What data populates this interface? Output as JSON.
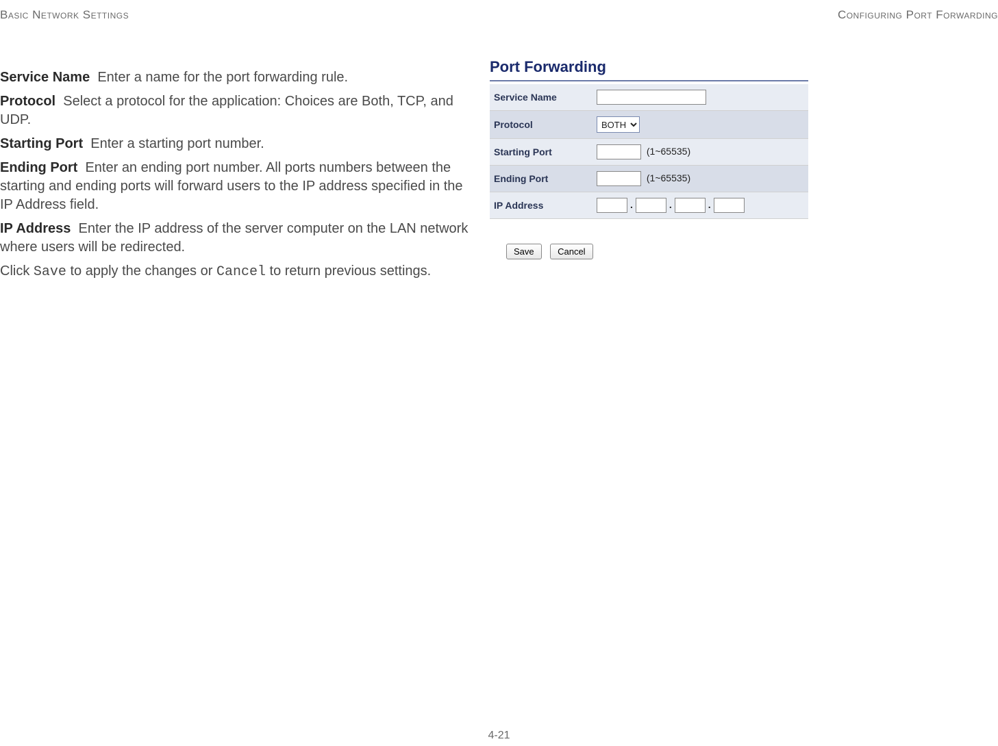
{
  "header": {
    "left": "Basic Network Settings",
    "right": "Configuring Port Forwarding"
  },
  "definitions": {
    "service_name": {
      "term": "Service Name",
      "desc": "Enter a name for the port forwarding rule."
    },
    "protocol": {
      "term": "Protocol",
      "desc": "Select a protocol for the application: Choices are Both, TCP, and UDP."
    },
    "starting_port": {
      "term": "Starting Port",
      "desc": "Enter a starting port number."
    },
    "ending_port": {
      "term": "Ending Port",
      "desc": "Enter an ending port number. All ports numbers between the starting and ending ports will forward users to the IP address specified in the IP Address field."
    },
    "ip_address": {
      "term": "IP Address",
      "desc": "Enter the IP address of the server computer on the LAN network where users will be redirected."
    },
    "footer_pre": "Click ",
    "footer_save": "Save",
    "footer_mid": " to apply the changes or ",
    "footer_cancel": "Cancel",
    "footer_post": " to return previous settings."
  },
  "panel": {
    "title": "Port Forwarding",
    "rows": {
      "service_name": {
        "label": "Service Name",
        "value": ""
      },
      "protocol": {
        "label": "Protocol",
        "value": "BOTH"
      },
      "starting_port": {
        "label": "Starting Port",
        "value": "",
        "hint": "(1~65535)"
      },
      "ending_port": {
        "label": "Ending Port",
        "value": "",
        "hint": "(1~65535)"
      },
      "ip_address": {
        "label": "IP Address",
        "octet1": "",
        "octet2": "",
        "octet3": "",
        "octet4": ""
      }
    },
    "buttons": {
      "save": "Save",
      "cancel": "Cancel"
    }
  },
  "page_number": "4-21"
}
